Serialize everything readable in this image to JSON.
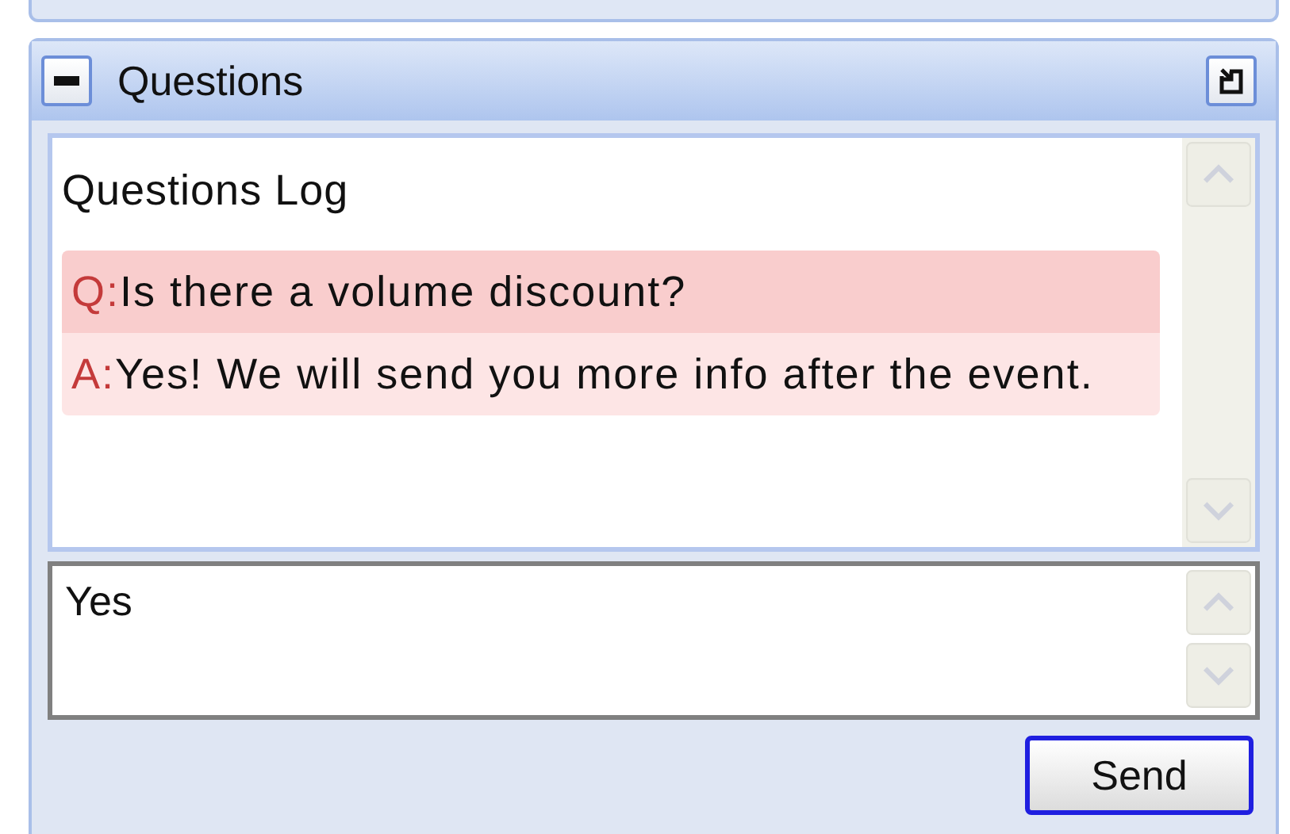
{
  "panel": {
    "title": "Questions"
  },
  "log": {
    "title": "Questions Log",
    "messages": [
      {
        "kind": "question",
        "label": "Q:",
        "text": "Is there a volume discount?"
      },
      {
        "kind": "answer",
        "label": "A:",
        "text": "Yes! We will send you more info after the event."
      }
    ]
  },
  "input": {
    "value": "Yes"
  },
  "send_button": {
    "label": "Send"
  }
}
